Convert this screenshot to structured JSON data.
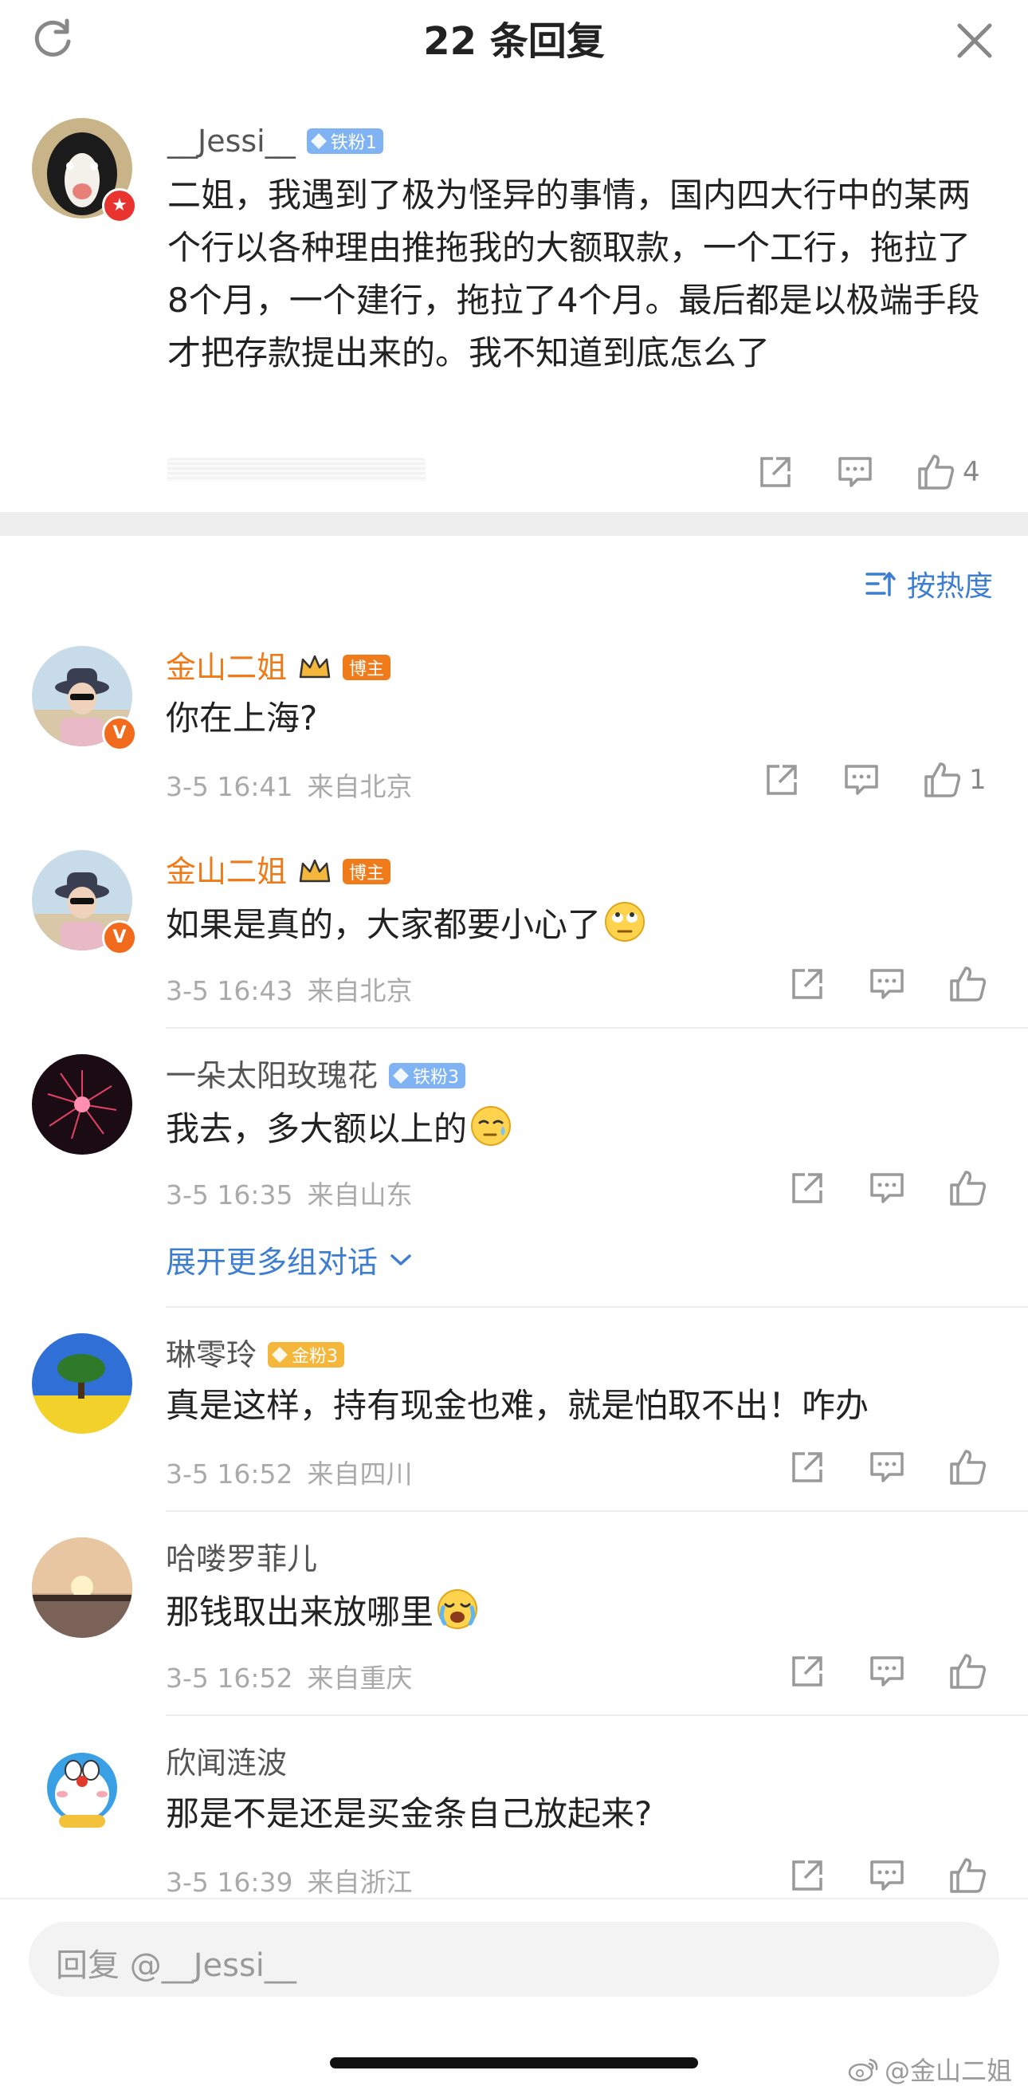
{
  "header": {
    "title": "22 条回复"
  },
  "post": {
    "username": "__Jessi__",
    "fan_tag": "铁粉1",
    "text": "二姐，我遇到了极为怪异的事情，国内四大行中的某两个行以各种理由推拖我的大额取款，一个工行，拖拉了8个月，一个建行，拖拉了4个月。最后都是以极端手段才把存款提出来的。我不知道到底怎么了",
    "like_count": "4"
  },
  "sort": {
    "label": "按热度"
  },
  "comments": [
    {
      "username": "金山二姐",
      "tag": "博主",
      "text": "你在上海?",
      "time": "3-5 16:41",
      "location": "来自北京",
      "like_count": "1"
    },
    {
      "username": "金山二姐",
      "tag": "博主",
      "text": "如果是真的，大家都要小心了",
      "time": "3-5 16:43",
      "location": "来自北京",
      "like_count": ""
    },
    {
      "username": "一朵太阳玫瑰花",
      "tag": "铁粉3",
      "text": "我去，多大额以上的",
      "time": "3-5 16:35",
      "location": "来自山东",
      "like_count": "",
      "expand_label": "展开更多组对话"
    },
    {
      "username": "琳零玲",
      "tag": "金粉3",
      "text": "真是这样，持有现金也难，就是怕取不出！咋办",
      "time": "3-5 16:52",
      "location": "来自四川",
      "like_count": ""
    },
    {
      "username": "哈喽罗菲儿",
      "tag": "",
      "text": "那钱取出来放哪里",
      "time": "3-5 16:52",
      "location": "来自重庆",
      "like_count": ""
    },
    {
      "username": "欣闻涟波",
      "tag": "",
      "text": "那是不是还是买金条自己放起来?",
      "time": "3-5 16:39",
      "location": "来自浙江",
      "like_count": ""
    }
  ],
  "reply": {
    "placeholder": "回复 @__Jessi__"
  },
  "watermark": "@金山二姐",
  "colors": {
    "accent": "#3e7ed0",
    "host_name": "#ef7a1a",
    "host_tag": "#f07b1a",
    "iron_fan": "#7fb3f3",
    "gold_fan": "#f4b63b"
  }
}
